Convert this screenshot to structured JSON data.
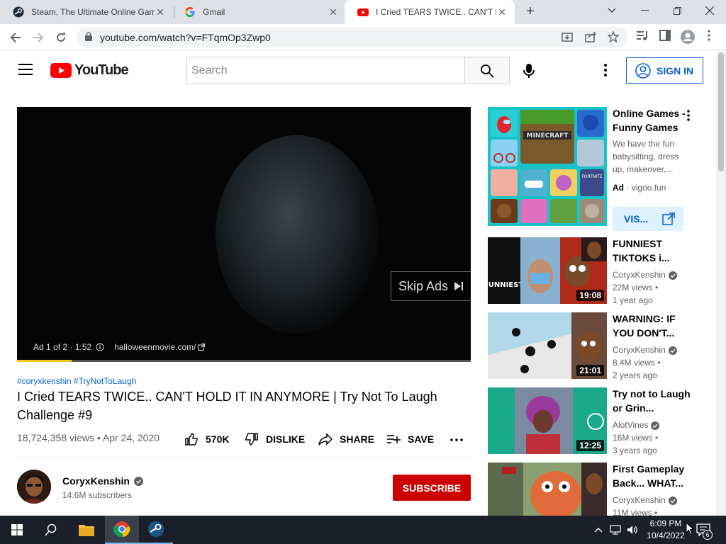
{
  "browser": {
    "tabs": [
      {
        "title": "Steam, The Ultimate Online Gam",
        "icon": "steam-icon"
      },
      {
        "title": "Gmail",
        "icon": "google-icon"
      },
      {
        "title": "I Cried TEARS TWICE.. CAN'T HO",
        "icon": "youtube-icon"
      }
    ],
    "url": "youtube.com/watch?v=FTqmOp3Zwp0"
  },
  "header": {
    "logo_text": "YouTube",
    "search_placeholder": "Search",
    "signin_label": "SIGN IN"
  },
  "player": {
    "skip_label": "Skip Ads",
    "ad_counter": "Ad 1 of 2 · 1:52",
    "ad_domain": "halloweenmovie.com/",
    "progress": 0.12
  },
  "video": {
    "hashtags": "#coryxkenshin #TryNotToLaugh",
    "title": "I Cried TEARS TWICE.. CAN'T HOLD IT IN ANYMORE | Try Not To Laugh Challenge #9",
    "views_date": "18,724,358 views • Apr 24, 2020",
    "likes": "570K",
    "dislike_label": "DISLIKE",
    "share_label": "SHARE",
    "save_label": "SAVE"
  },
  "channel": {
    "name": "CoryxKenshin",
    "subscribers": "14.6M subscribers",
    "subscribe_label": "SUBSCRIBE"
  },
  "ad_card": {
    "title": "Online Games - Funny Games",
    "description": "We have the fun babysitting, dress up, makeover,...",
    "ad_label": "Ad",
    "domain": "· vigoo.fun",
    "visit_label": "VIS..."
  },
  "related": [
    {
      "title": "FUNNIEST TIKTOKS i...",
      "channel": "CoryxKenshin",
      "verified": true,
      "views": "22M views •",
      "age": "1 year ago",
      "duration": "19:08"
    },
    {
      "title": "WARNING: IF YOU DON'T...",
      "channel": "CoryxKenshin",
      "verified": true,
      "views": "8.4M views •",
      "age": "2 years ago",
      "duration": "21:01"
    },
    {
      "title": "Try not to Laugh or Grin...",
      "channel": "AlotVines",
      "verified": true,
      "views": "16M views •",
      "age": "3 years ago",
      "duration": "12:25"
    },
    {
      "title": "First Gameplay Back... WHAT...",
      "channel": "CoryxKenshin",
      "verified": true,
      "views": "11M views •",
      "age": "",
      "duration": ""
    }
  ],
  "taskbar": {
    "time": "6:09 PM",
    "date": "10/4/2022",
    "notification_count": "6"
  }
}
